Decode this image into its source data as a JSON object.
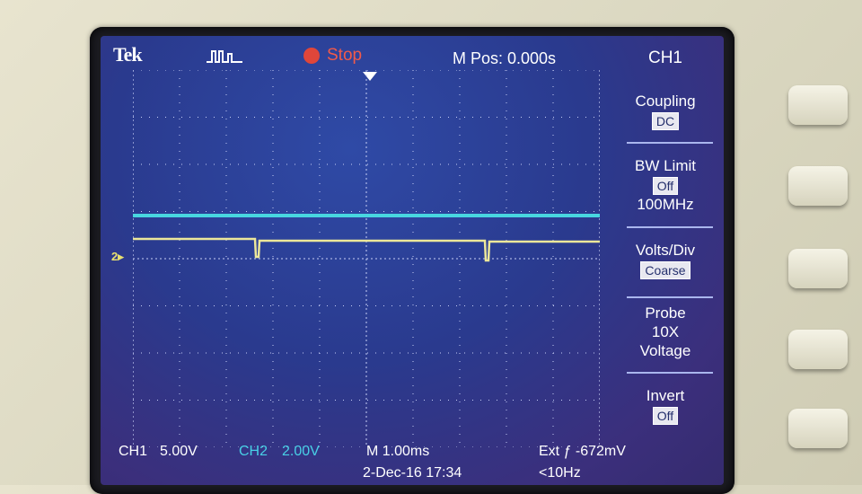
{
  "header": {
    "brand": "Tek",
    "acquire_icon": "pulse-waveform-icon",
    "run_state": "Stop",
    "run_state_icon": "stop-dot-icon",
    "m_pos": "M Pos: 0.000s"
  },
  "side_menu": {
    "title": "CH1",
    "items": [
      {
        "label": "Coupling",
        "value": "DC"
      },
      {
        "label": "BW Limit",
        "value": "Off",
        "extra": "100MHz"
      },
      {
        "label": "Volts/Div",
        "value": "Coarse"
      },
      {
        "label": "Probe",
        "line2": "10X",
        "line3": "Voltage"
      },
      {
        "label": "Invert",
        "value": "Off"
      }
    ]
  },
  "status": {
    "ch1": "CH1",
    "ch1_scale": "5.00V",
    "ch2": "CH2",
    "ch2_scale": "2.00V",
    "timebase": "M 1.00ms",
    "trigger": "Ext ƒ -672mV",
    "date": "2-Dec-16 17:34",
    "freq": "<10Hz"
  },
  "channel_marker": "2",
  "colors": {
    "ch1_trace": "#48d6e0",
    "ch2_trace": "#ece79a",
    "stop": "#e0463a"
  }
}
